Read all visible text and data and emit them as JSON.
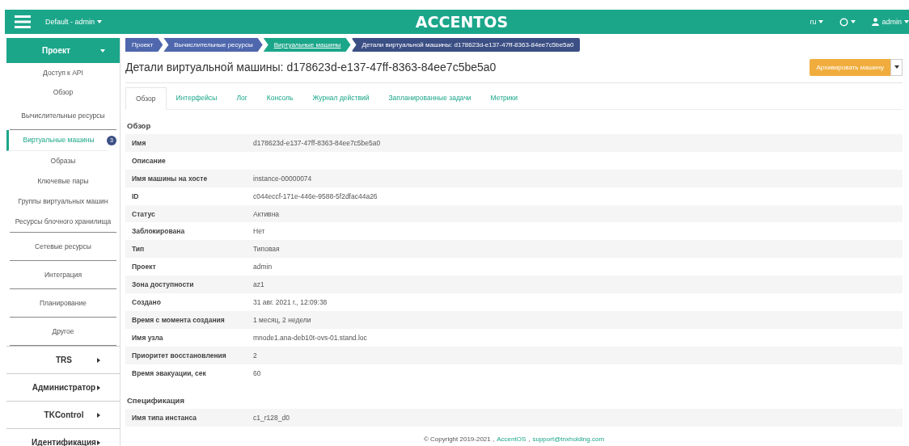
{
  "topbar": {
    "project_menu": "Default - admin",
    "logo": "ACCENTOS",
    "language": "ru",
    "user": "admin"
  },
  "sidebar": {
    "header": {
      "label": "Проект",
      "expanded": true
    },
    "items": [
      {
        "label": "Доступ к API",
        "selected": false
      },
      {
        "label": "Обзор",
        "selected": false
      },
      {
        "label": "Вычислительные ресурсы",
        "selected": false,
        "children": [
          {
            "label": "Виртуальные машины",
            "selected": true,
            "badge": "3"
          },
          {
            "label": "Образы",
            "selected": false
          },
          {
            "label": "Ключевые пары",
            "selected": false
          },
          {
            "label": "Группы виртуальных машин",
            "selected": false
          },
          {
            "label": "Ресурсы блочного хранилища",
            "selected": false
          }
        ]
      },
      {
        "label": "Сетевые ресурсы",
        "selected": false
      },
      {
        "label": "Интеграция",
        "selected": false
      },
      {
        "label": "Планирование",
        "selected": false
      },
      {
        "label": "Другое",
        "selected": false
      }
    ],
    "sections": [
      {
        "label": "TRS",
        "expanded": false
      },
      {
        "label": "Администратор",
        "expanded": false
      },
      {
        "label": "TKControl",
        "expanded": false
      },
      {
        "label": "Идентификация",
        "expanded": false
      }
    ]
  },
  "breadcrumb": [
    {
      "label": "Проект",
      "kind": "link",
      "color": "#4f67ad"
    },
    {
      "label": "Вычислительные ресурсы",
      "kind": "link",
      "color": "#4f67ad"
    },
    {
      "label": "Виртуальные машины",
      "kind": "active",
      "color": "#1ba68a"
    },
    {
      "label": "Детали виртуальной машины: d178623d-e137-47ff-8363-84ee7c5be5a0",
      "kind": "current",
      "color": "#3b4f85"
    }
  ],
  "page_title": "Детали виртуальной машины: d178623d-e137-47ff-8363-84ee7c5be5a0",
  "action_button": "Архивировать машину",
  "tabs": [
    {
      "label": "Обзор",
      "selected": true
    },
    {
      "label": "Интерфейсы",
      "selected": false
    },
    {
      "label": "Лог",
      "selected": false
    },
    {
      "label": "Консоль",
      "selected": false
    },
    {
      "label": "Журнал действий",
      "selected": false
    },
    {
      "label": "Запланированные задачи",
      "selected": false
    },
    {
      "label": "Метрики",
      "selected": false
    }
  ],
  "sections": [
    {
      "title": "Обзор",
      "rows": [
        {
          "label": "Имя",
          "value": "d178623d-e137-47ff-8363-84ee7c5be5a0"
        },
        {
          "label": "Описание"
        },
        {
          "label": "Имя машины на хосте",
          "value": "instance-00000074"
        },
        {
          "label": "ID",
          "value": "c044eccf-171e-446e-9588-5f2dfac44a26"
        },
        {
          "label": "Статус",
          "value": "Активна"
        },
        {
          "label": "Заблокирована",
          "value": "Нет"
        },
        {
          "label": "Тип",
          "value": "Типовая"
        },
        {
          "label": "Проект",
          "value": "admin"
        },
        {
          "label": "Зона доступности",
          "value": "az1"
        },
        {
          "label": "Создано",
          "value": "31 авг. 2021 г., 12:09:38"
        },
        {
          "label": "Время с момента создания",
          "value": "1 месяц, 2 недели"
        },
        {
          "label": "Имя узла",
          "value": "mnode1.ana-deb10t-ovs-01.stand.loc"
        },
        {
          "label": "Приоритет восстановления",
          "value": "2"
        },
        {
          "label": "Время эвакуации, сек",
          "value": "60"
        }
      ]
    },
    {
      "title": "Спецификация",
      "rows": [
        {
          "label": "Имя типа инстанса",
          "value": "c1_r128_d0"
        }
      ]
    }
  ],
  "footer": {
    "copyright": "© Copyright 2019-2021 ,",
    "product_link": "AccentOS",
    "separator": ",",
    "support_link": "support@tnxholding.com"
  }
}
